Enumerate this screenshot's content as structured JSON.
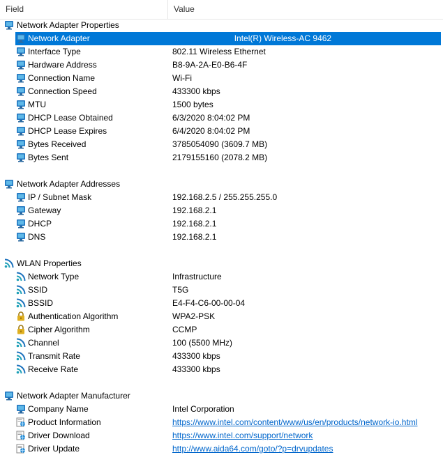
{
  "header": {
    "field": "Field",
    "value": "Value"
  },
  "rows": [
    {
      "type": "section",
      "icon": "network-icon",
      "field": "Network Adapter Properties"
    },
    {
      "type": "item",
      "icon": "network-icon",
      "field": "Network Adapter",
      "value": "Intel(R) Wireless-AC 9462",
      "selected": true
    },
    {
      "type": "item",
      "icon": "network-icon",
      "field": "Interface Type",
      "value": "802.11 Wireless Ethernet"
    },
    {
      "type": "item",
      "icon": "network-icon",
      "field": "Hardware Address",
      "value": "B8-9A-2A-E0-B6-4F"
    },
    {
      "type": "item",
      "icon": "network-icon",
      "field": "Connection Name",
      "value": "Wi-Fi"
    },
    {
      "type": "item",
      "icon": "network-icon",
      "field": "Connection Speed",
      "value": "433300 kbps"
    },
    {
      "type": "item",
      "icon": "network-icon",
      "field": "MTU",
      "value": "1500 bytes"
    },
    {
      "type": "item",
      "icon": "network-icon",
      "field": "DHCP Lease Obtained",
      "value": "6/3/2020 8:04:02 PM"
    },
    {
      "type": "item",
      "icon": "network-icon",
      "field": "DHCP Lease Expires",
      "value": "6/4/2020 8:04:02 PM"
    },
    {
      "type": "item",
      "icon": "network-icon",
      "field": "Bytes Received",
      "value": "3785054090 (3609.7 MB)"
    },
    {
      "type": "item",
      "icon": "network-icon",
      "field": "Bytes Sent",
      "value": "2179155160 (2078.2 MB)"
    },
    {
      "type": "gap"
    },
    {
      "type": "section",
      "icon": "network-icon",
      "field": "Network Adapter Addresses"
    },
    {
      "type": "item",
      "icon": "network-icon",
      "field": "IP / Subnet Mask",
      "value": "192.168.2.5 / 255.255.255.0"
    },
    {
      "type": "item",
      "icon": "network-icon",
      "field": "Gateway",
      "value": "192.168.2.1"
    },
    {
      "type": "item",
      "icon": "network-icon",
      "field": "DHCP",
      "value": "192.168.2.1"
    },
    {
      "type": "item",
      "icon": "network-icon",
      "field": "DNS",
      "value": "192.168.2.1"
    },
    {
      "type": "gap"
    },
    {
      "type": "section",
      "icon": "wifi-icon",
      "field": "WLAN Properties"
    },
    {
      "type": "item",
      "icon": "wifi-icon",
      "field": "Network Type",
      "value": "Infrastructure"
    },
    {
      "type": "item",
      "icon": "wifi-icon",
      "field": "SSID",
      "value": "T5G"
    },
    {
      "type": "item",
      "icon": "wifi-icon",
      "field": "BSSID",
      "value": "E4-F4-C6-00-00-04"
    },
    {
      "type": "item",
      "icon": "lock-icon",
      "field": "Authentication Algorithm",
      "value": "WPA2-PSK"
    },
    {
      "type": "item",
      "icon": "lock-icon",
      "field": "Cipher Algorithm",
      "value": "CCMP"
    },
    {
      "type": "item",
      "icon": "wifi-icon",
      "field": "Channel",
      "value": "100 (5500 MHz)"
    },
    {
      "type": "item",
      "icon": "wifi-icon",
      "field": "Transmit Rate",
      "value": "433300 kbps"
    },
    {
      "type": "item",
      "icon": "wifi-icon",
      "field": "Receive Rate",
      "value": "433300 kbps"
    },
    {
      "type": "gap"
    },
    {
      "type": "section",
      "icon": "network-icon",
      "field": "Network Adapter Manufacturer"
    },
    {
      "type": "item",
      "icon": "network-icon",
      "field": "Company Name",
      "value": "Intel Corporation"
    },
    {
      "type": "item",
      "icon": "globe-icon",
      "field": "Product Information",
      "value": "https://www.intel.com/content/www/us/en/products/network-io.html",
      "link": true
    },
    {
      "type": "item",
      "icon": "globe-icon",
      "field": "Driver Download",
      "value": "https://www.intel.com/support/network",
      "link": true
    },
    {
      "type": "item",
      "icon": "globe-icon",
      "field": "Driver Update",
      "value": "http://www.aida64.com/goto/?p=drvupdates",
      "link": true
    }
  ],
  "colors": {
    "selection": "#0078d7",
    "link": "#0066cc",
    "icon_blue": "#1e73be",
    "icon_teal": "#1fa0b8",
    "lock_gold": "#e0b020"
  }
}
